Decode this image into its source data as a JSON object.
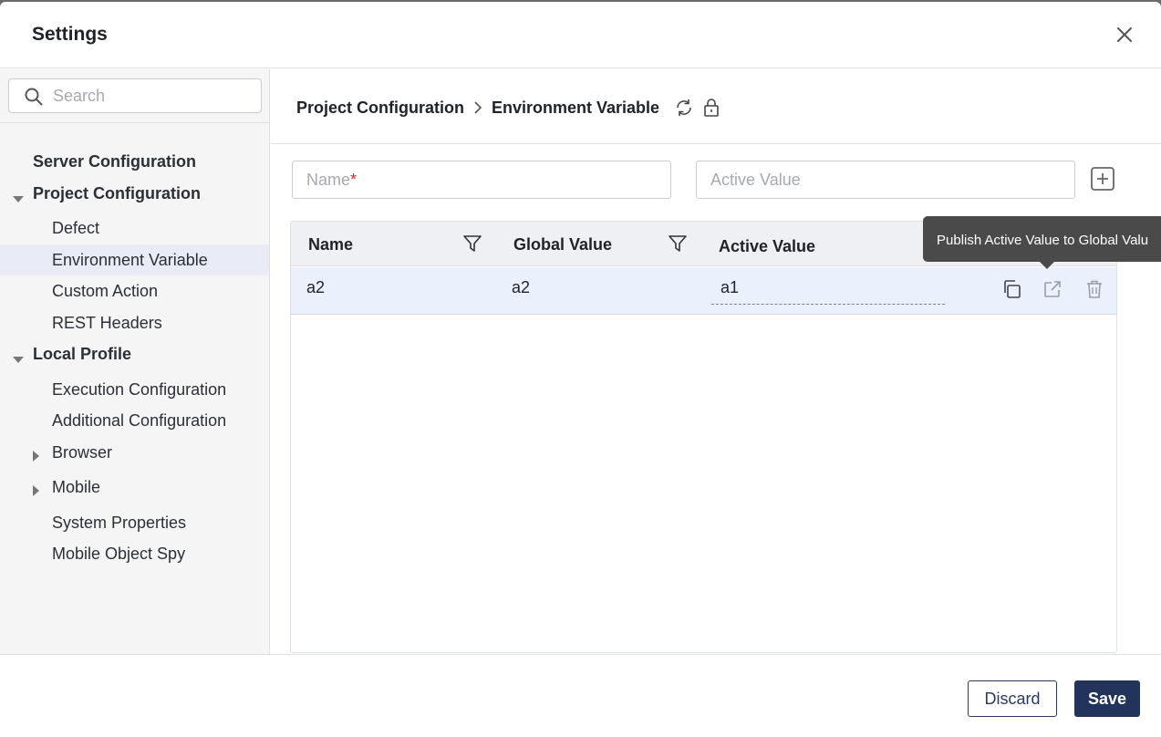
{
  "dialog": {
    "title": "Settings"
  },
  "sidebar": {
    "search_placeholder": "Search",
    "items": [
      {
        "label": "Server Configuration"
      },
      {
        "label": "Project Configuration"
      },
      {
        "label": "Defect"
      },
      {
        "label": "Environment Variable"
      },
      {
        "label": "Custom Action"
      },
      {
        "label": "REST Headers"
      },
      {
        "label": "Local Profile"
      },
      {
        "label": "Execution Configuration"
      },
      {
        "label": "Additional Configuration"
      },
      {
        "label": "Browser"
      },
      {
        "label": "Mobile"
      },
      {
        "label": "System Properties"
      },
      {
        "label": "Mobile Object Spy"
      }
    ]
  },
  "breadcrumb": {
    "parent": "Project Configuration",
    "current": "Environment Variable"
  },
  "form": {
    "name_placeholder": "Name",
    "name_required_mark": "*",
    "active_value_placeholder": "Active Value"
  },
  "table": {
    "columns": [
      "Name",
      "Global Value",
      "Active Value"
    ],
    "rows": [
      {
        "name": "a2",
        "global_value": "a2",
        "active_value": "a1"
      }
    ]
  },
  "tooltip": {
    "text": "Publish Active Value to Global Valu"
  },
  "footer": {
    "discard_label": "Discard",
    "save_label": "Save"
  },
  "colors": {
    "primary": "#23345c",
    "selected_row": "#eaf1fc",
    "active_nav": "#e9ecf6",
    "required": "#d32f2f"
  }
}
